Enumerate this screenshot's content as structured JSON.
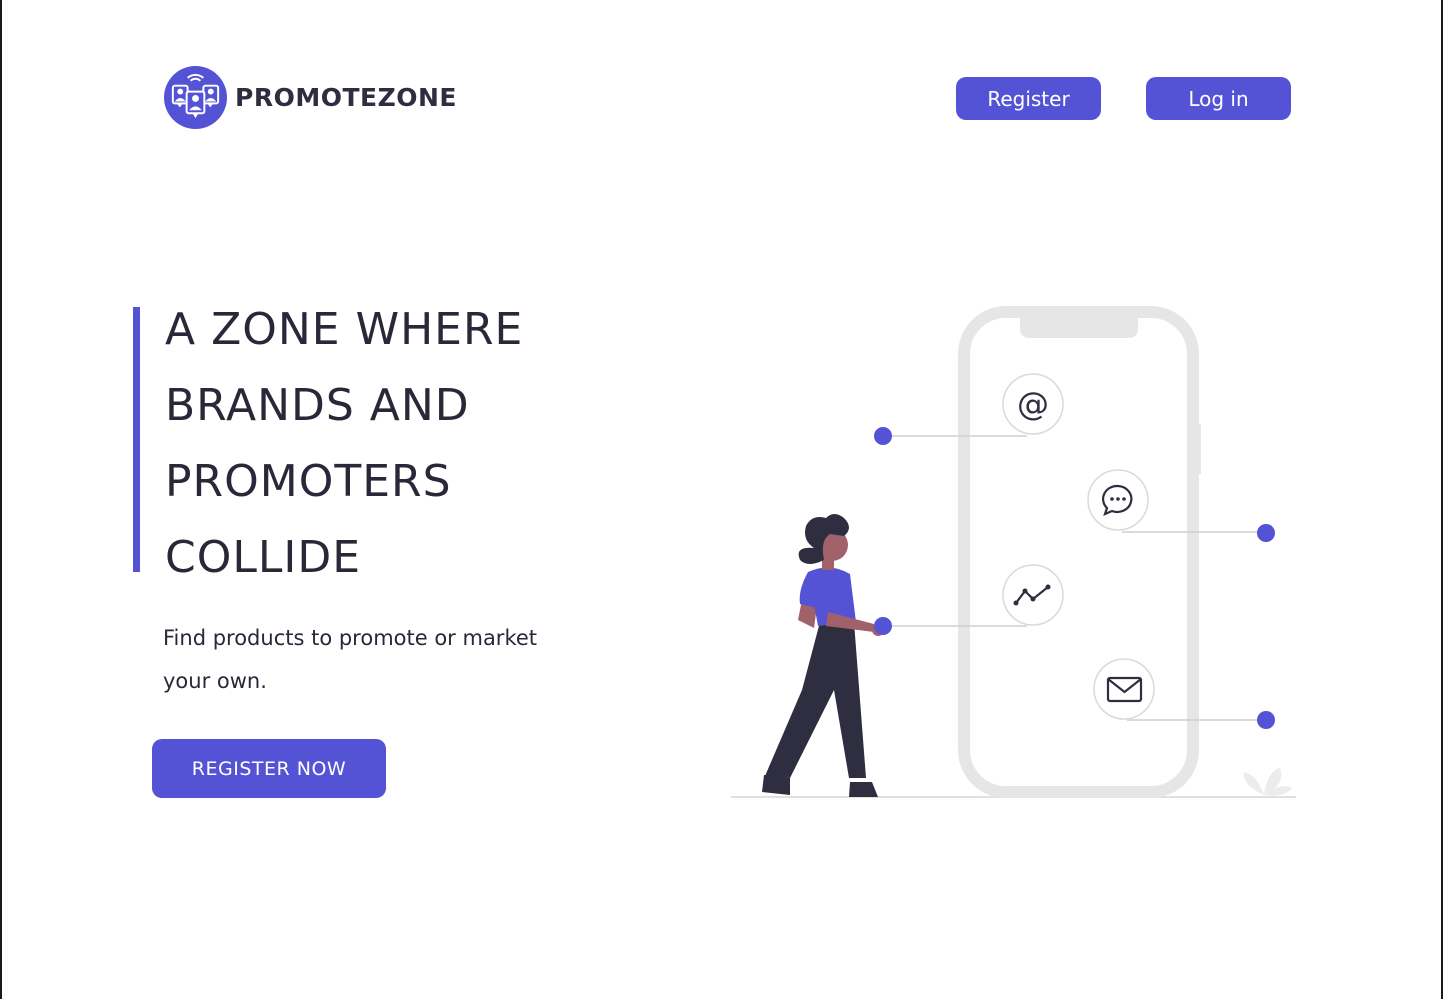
{
  "brand": {
    "name": "PROMOTEZONE",
    "logo_icon": "promoters-group-icon",
    "accent_color": "#5453d6"
  },
  "header": {
    "register_label": "Register",
    "login_label": "Log in"
  },
  "hero": {
    "title_lines": [
      "A ZONE WHERE",
      "BRANDS AND",
      "PROMOTERS",
      "COLLIDE"
    ],
    "subtitle": "Find products to promote or market your own.",
    "cta_label": "REGISTER NOW"
  },
  "illustration": {
    "icons": [
      "at-sign-icon",
      "chat-bubble-icon",
      "trend-line-icon",
      "envelope-icon"
    ],
    "figure": "woman-pointing-at-phone",
    "colors": {
      "phone_outline": "#e6e6e6",
      "dot": "#5453d6",
      "shirt": "#5453d6",
      "pants": "#2f2e41",
      "skin": "#a0616a"
    }
  }
}
